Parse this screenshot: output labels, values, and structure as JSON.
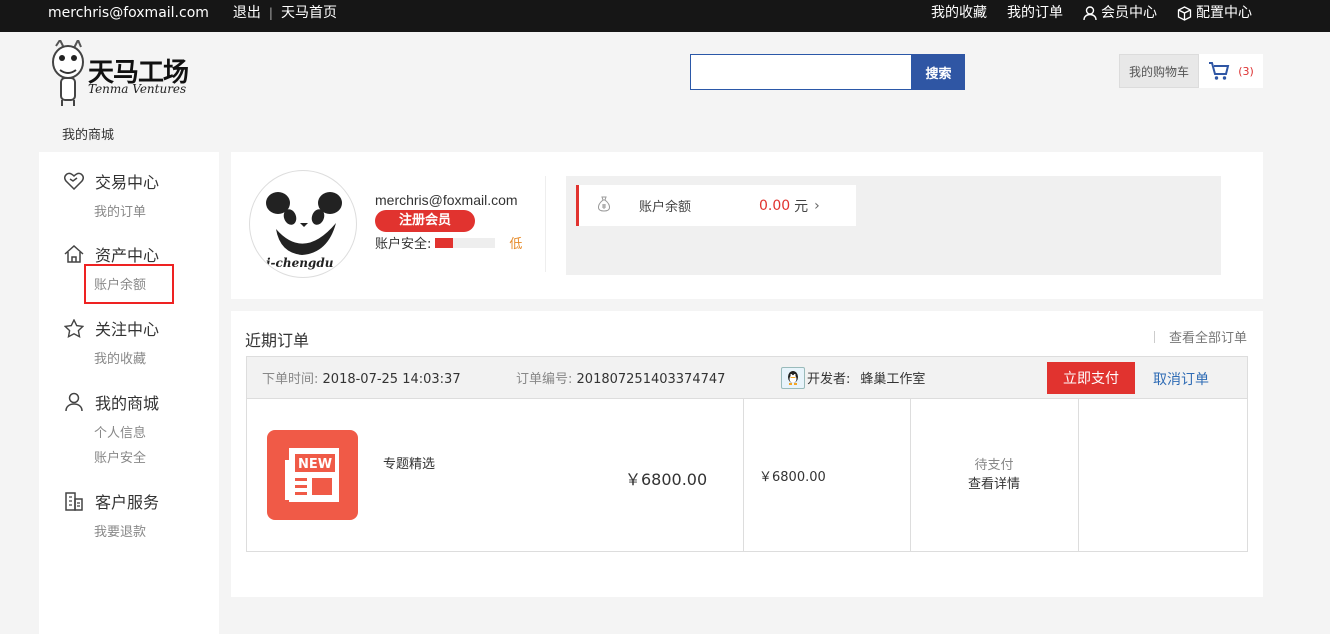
{
  "topbar": {
    "email": "merchris@foxmail.com",
    "logout": "退出",
    "home": "天马首页",
    "favorites": "我的收藏",
    "my_orders": "我的订单",
    "member_center": "会员中心",
    "config_center": "配置中心"
  },
  "header": {
    "logo_title": "天马工场",
    "logo_subtitle": "Tenma Ventures",
    "search_placeholder": "",
    "search_button": "搜索",
    "cart_label": "我的购物车",
    "cart_count": "(3)",
    "breadcrumb": "我的商城"
  },
  "sidebar": {
    "sections": [
      {
        "title": "交易中心",
        "icon": "handshake-icon",
        "items": [
          "我的订单"
        ]
      },
      {
        "title": "资产中心",
        "icon": "house-icon",
        "items": [
          "账户余额"
        ]
      },
      {
        "title": "关注中心",
        "icon": "star-icon",
        "items": [
          "我的收藏"
        ]
      },
      {
        "title": "我的商城",
        "icon": "user-icon",
        "items": [
          "个人信息",
          "账户安全"
        ]
      },
      {
        "title": "客户服务",
        "icon": "building-icon",
        "items": [
          "我要退款"
        ]
      }
    ]
  },
  "profile": {
    "avatar_text": "i-chengdu",
    "email": "merchris@foxmail.com",
    "badge": "注册会员",
    "security_label": "账户安全:",
    "security_level": "低",
    "security_fraction": 0.3,
    "balance_label": "账户余额",
    "balance_value": "0.00",
    "balance_unit": "元"
  },
  "orders": {
    "title": "近期订单",
    "view_all": "查看全部订单",
    "order_time_label": "下单时间:",
    "order_time": "2018-07-25 14:03:37",
    "order_no_label": "订单编号:",
    "order_no": "20180725140337474​7",
    "developer_label": "开发者:",
    "developer": "蜂巢工作室",
    "pay_button": "立即支付",
    "cancel_button": "取消订单",
    "product_badge": "NEW",
    "product_name": "专题精选",
    "unit_price": "￥6800.00",
    "total_price": "￥6800.00",
    "status": "待支付",
    "detail_link": "查看详情"
  },
  "colors": {
    "accent_red": "#e1332f",
    "search_blue": "#2f56a4",
    "link_blue": "#2f6cb5",
    "level_orange": "#e68a28"
  }
}
